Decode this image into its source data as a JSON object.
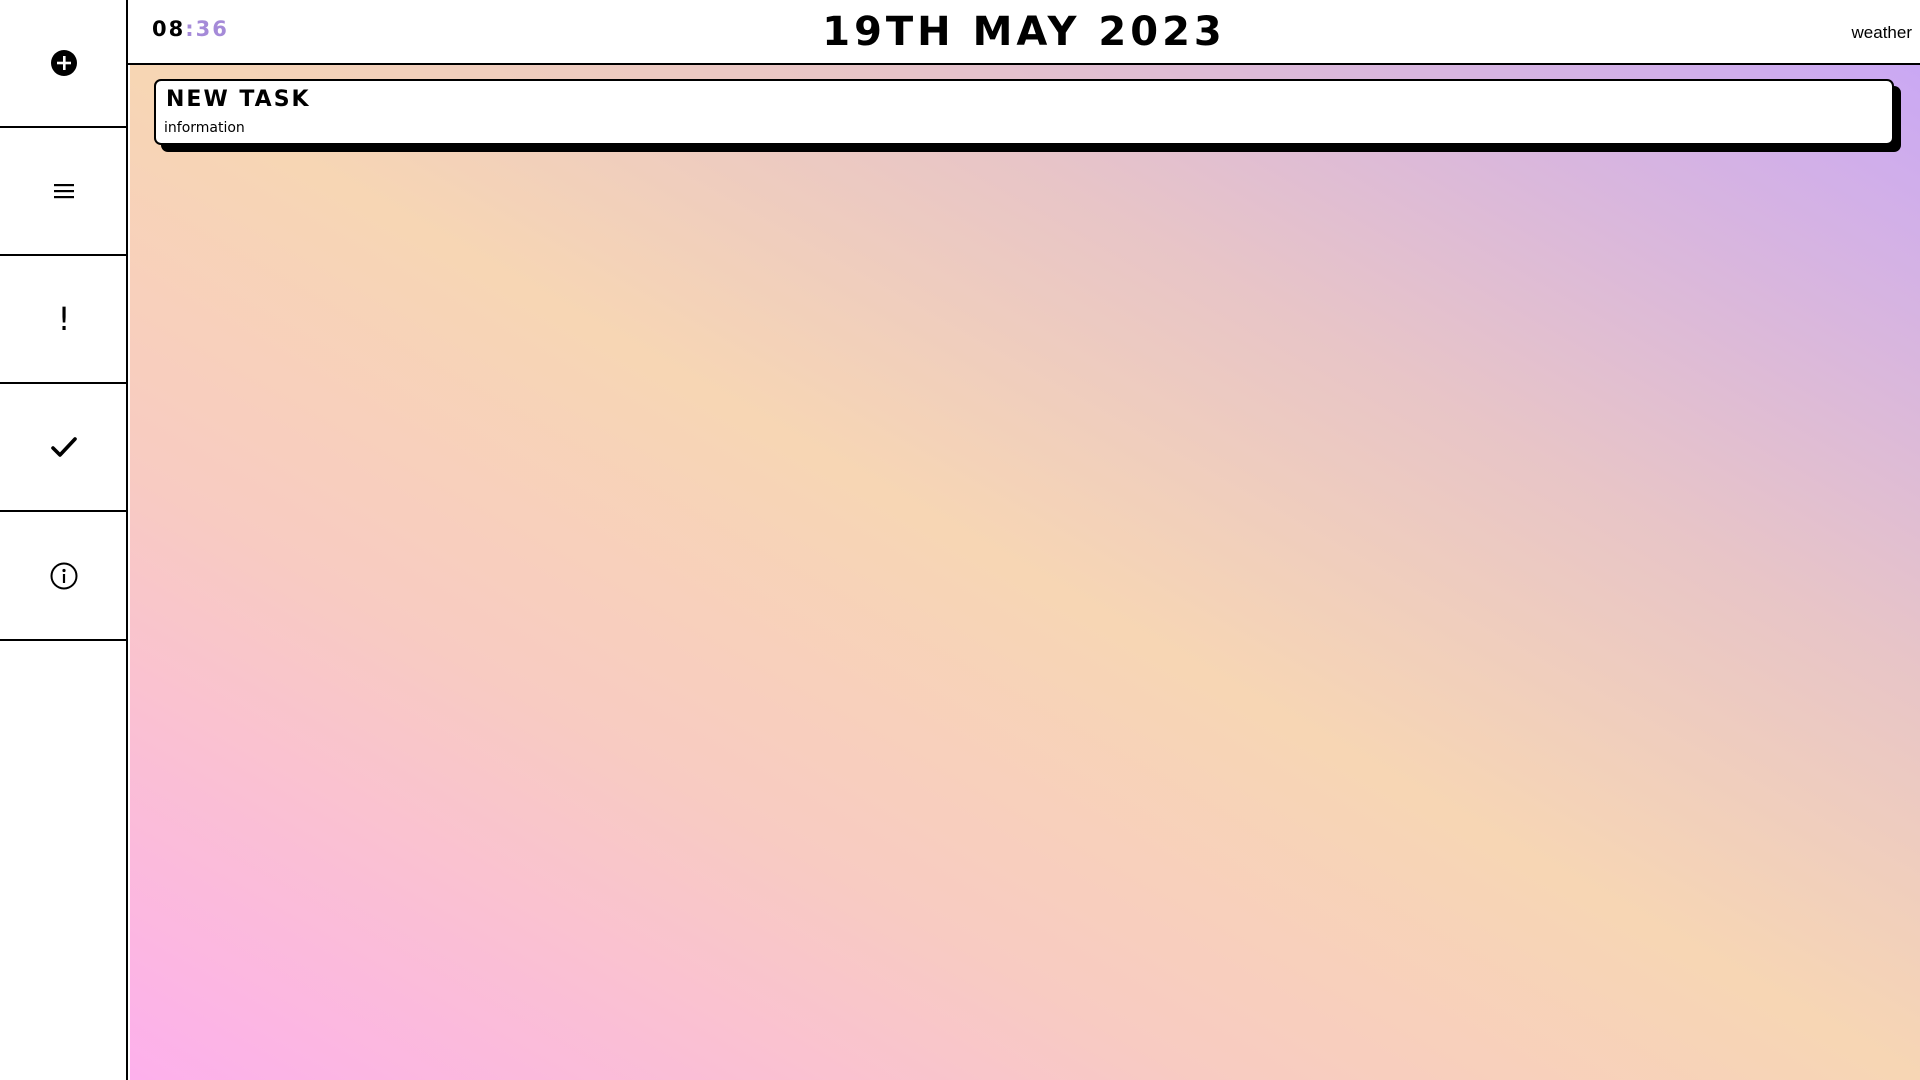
{
  "sidebar": {
    "items": [
      {
        "icon": "add-circle-icon"
      },
      {
        "icon": "menu-icon"
      },
      {
        "icon": "exclamation-icon",
        "glyph": "!"
      },
      {
        "icon": "checkmark-icon"
      },
      {
        "icon": "info-icon"
      }
    ]
  },
  "header": {
    "clock": {
      "hours": "08",
      "separator": ":",
      "minutes": "36"
    },
    "date": "19TH MAY 2023",
    "weather": "weather"
  },
  "tasks": [
    {
      "title": "NEW TASK",
      "info": "information"
    }
  ],
  "colors": {
    "accent": "#a58ad8",
    "gradient": [
      "#fdb0ec",
      "#f8cbc2",
      "#f7d6b4",
      "#e8c5c7",
      "#caa8f4"
    ]
  }
}
